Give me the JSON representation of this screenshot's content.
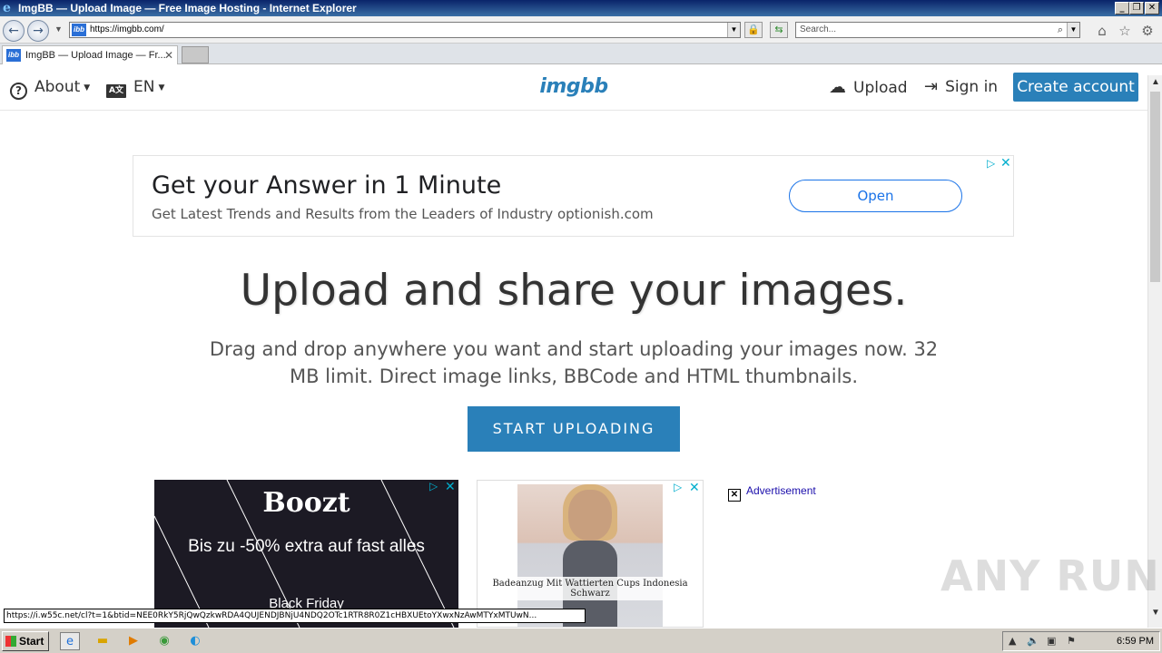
{
  "browser": {
    "title": "ImgBB — Upload Image — Free Image Hosting - Internet Explorer",
    "address": "https://imgbb.com/",
    "search_placeholder": "Search...",
    "tab_label": "ImgBB — Upload Image — Fr...",
    "favicon_text": "ibb",
    "status_url": "https://i.w55c.net/cl?t=1&btid=NEE0RkY5RjQwQzkwRDA4QUJENDJBNjU4NDQ2OTc1RTR8R0Z1cHBXUEtoYXwxNzAwMTYxMTUwN..."
  },
  "header": {
    "about_label": "About",
    "lang_label": "EN",
    "lang_icon_text": "A文",
    "logo_text": "imgbb",
    "upload_label": "Upload",
    "signin_label": "Sign in",
    "create_account_label": "Create account"
  },
  "top_ad": {
    "title": "Get your Answer in 1 Minute",
    "subtitle": "Get Latest Trends and Results from the Leaders of Industry optionish.com",
    "button": "Open"
  },
  "hero": {
    "title": "Upload and share your images.",
    "description": "Drag and drop anywhere you want and start uploading your images now. 32 MB limit. Direct image links, BBCode and HTML thumbnails.",
    "button": "START UPLOADING"
  },
  "ads": {
    "boozt_brand": "Boozt",
    "boozt_promo": "Bis zu -50% extra auf fast alles",
    "boozt_event": "Black Friday",
    "swim_caption": "Badeanzug Mit Wattierten Cups Indonesia Schwarz",
    "advertisement_label": "Advertisement"
  },
  "watermark": "ANY RUN",
  "taskbar": {
    "start_label": "Start",
    "clock": "6:59 PM"
  },
  "colors": {
    "accent": "#2a80b9",
    "ad_blue": "#1a73e8",
    "adchoices": "#00aecd"
  }
}
